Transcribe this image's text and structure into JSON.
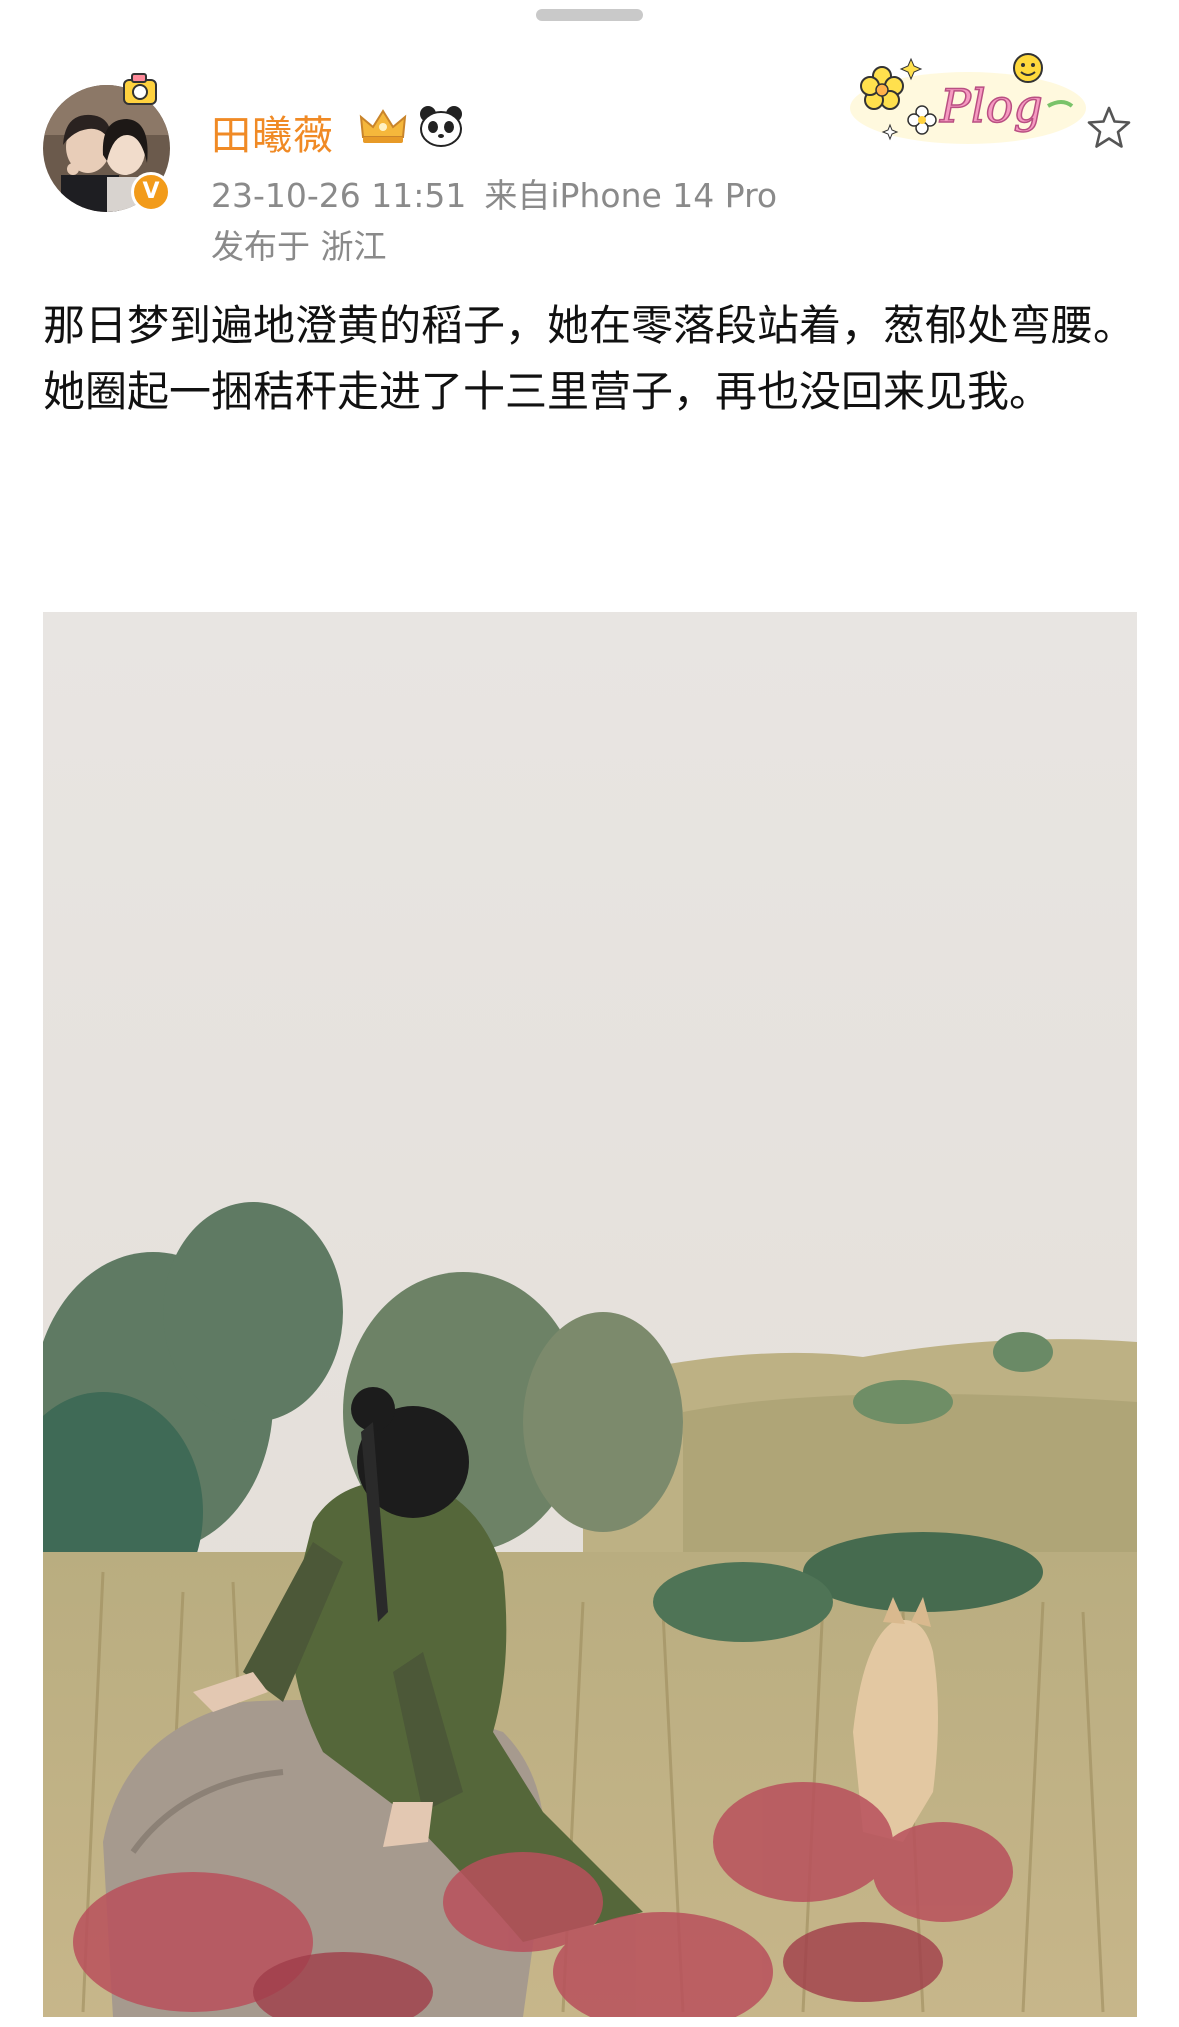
{
  "post": {
    "author_name": "田曦薇",
    "timestamp": "23-10-26 11:51",
    "source": "来自iPhone 14 Pro",
    "location": "发布于 浙江",
    "text_lines": [
      "那日梦到遍地澄黄的稻子，她在零落段站着，葱郁处弯腰。",
      "她圈起一捆秸秆走进了十三里营子，再也没回来见我。"
    ],
    "sticker_text": "Plog"
  },
  "badges": {
    "verified_letter": "V"
  },
  "icons": {
    "favorite": "star-outline-icon",
    "verified": "verified-badge-icon",
    "crown": "crown-badge-icon",
    "panda": "panda-badge-icon"
  },
  "colors": {
    "username": "#f08a25",
    "meta": "#8a8a8a",
    "verified": "#f29b1a"
  }
}
